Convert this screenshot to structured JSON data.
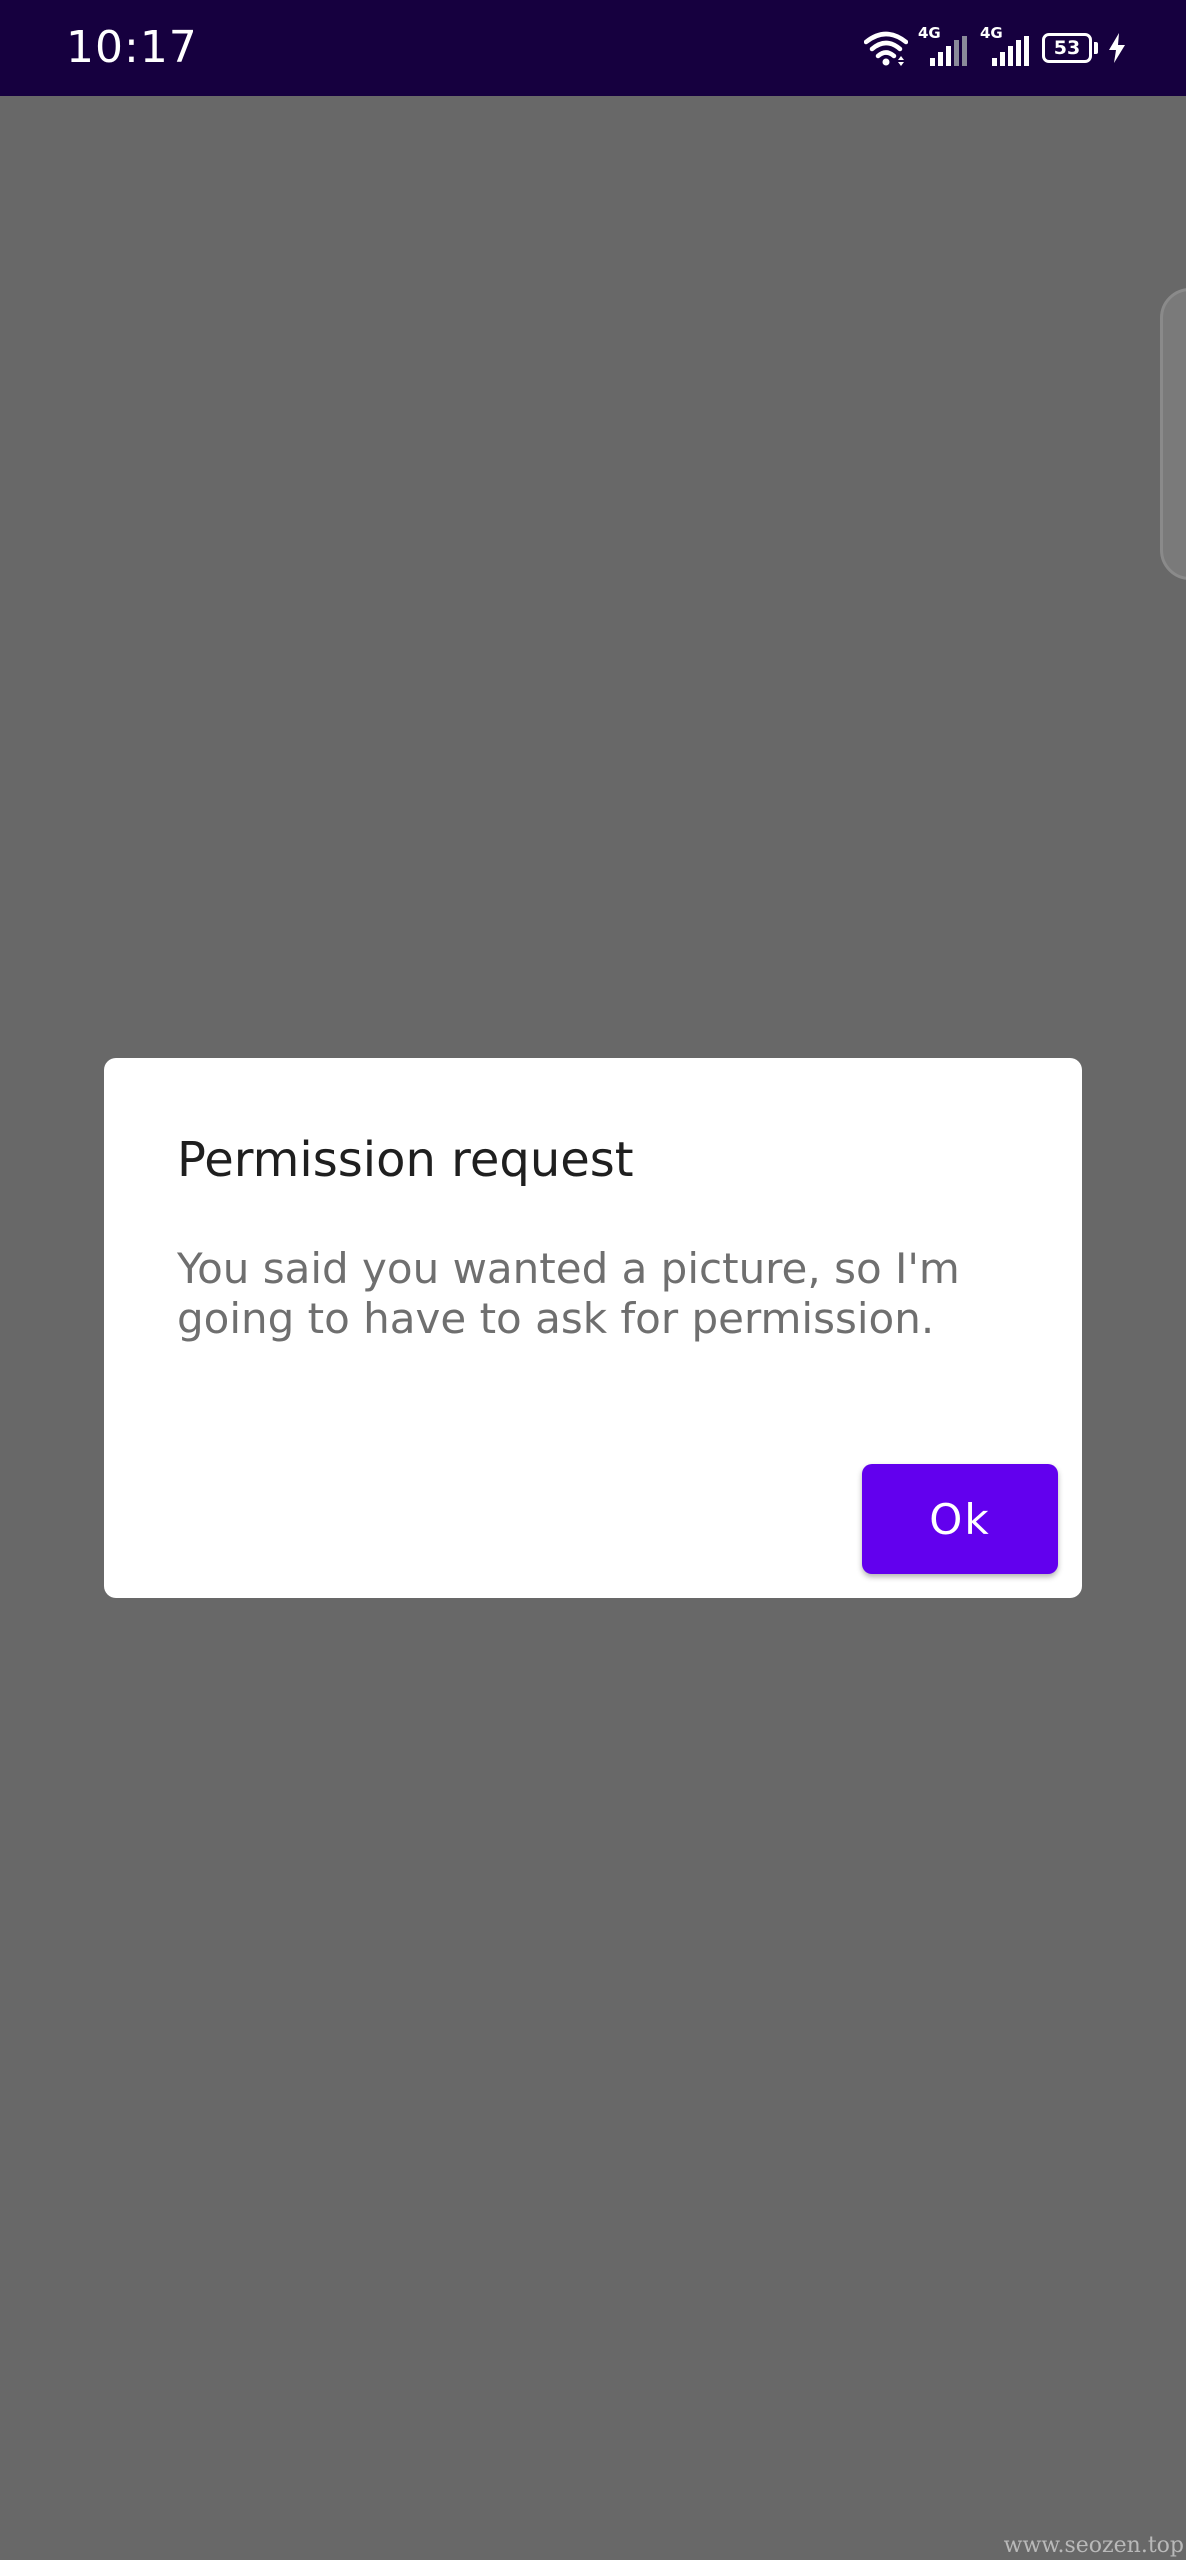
{
  "status_bar": {
    "time": "10:17",
    "network_1": "4G",
    "network_2": "4G",
    "battery_level": "53",
    "icons": [
      "wifi-icon",
      "signal-icon",
      "signal-icon",
      "battery-icon",
      "charging-icon"
    ],
    "background": "#16003f"
  },
  "dialog": {
    "title": "Permission request",
    "message": "You said you wanted a picture, so I'm going to have to ask for permission.",
    "ok_label": "Ok",
    "accent": "#6200ee"
  },
  "watermark": "www.seozen.top"
}
